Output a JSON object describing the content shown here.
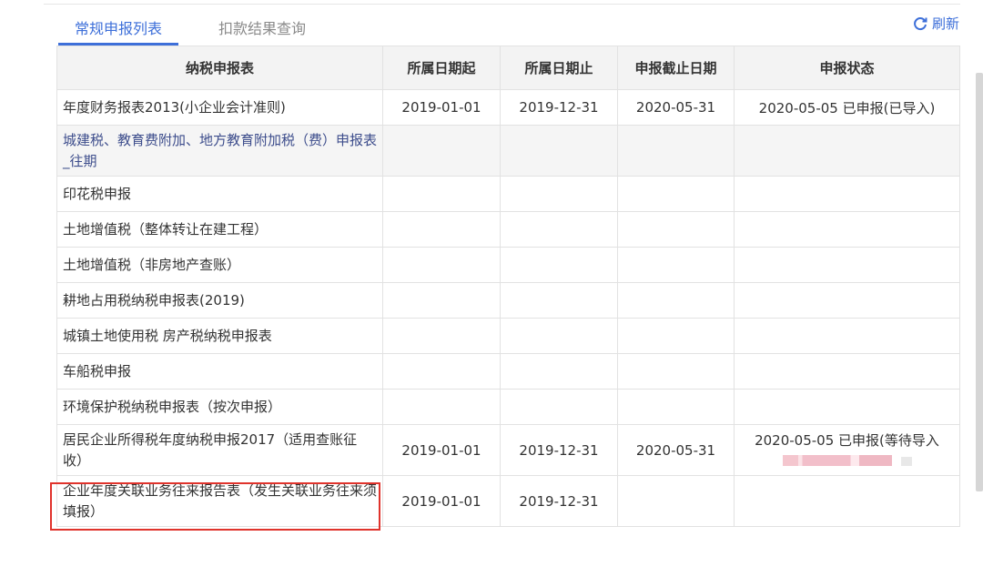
{
  "tabs": [
    {
      "label": "常规申报列表",
      "active": true
    },
    {
      "label": "扣款结果查询",
      "active": false
    }
  ],
  "refresh_label": "刷新",
  "table": {
    "headers": [
      "纳税申报表",
      "所属日期起",
      "所属日期止",
      "申报截止日期",
      "申报状态"
    ],
    "rows": [
      {
        "name": "年度财务报表2013(小企业会计准则)",
        "start": "2019-01-01",
        "end": "2019-12-31",
        "deadline": "2020-05-31",
        "status": "2020-05-05 已申报(已导入)"
      },
      {
        "name": "城建税、教育费附加、地方教育附加税（费）申报表_往期",
        "start": "",
        "end": "",
        "deadline": "",
        "status": ""
      },
      {
        "name": "印花税申报",
        "start": "",
        "end": "",
        "deadline": "",
        "status": ""
      },
      {
        "name": "土地增值税（整体转让在建工程）",
        "start": "",
        "end": "",
        "deadline": "",
        "status": ""
      },
      {
        "name": "土地增值税（非房地产查账）",
        "start": "",
        "end": "",
        "deadline": "",
        "status": ""
      },
      {
        "name": "耕地占用税纳税申报表(2019)",
        "start": "",
        "end": "",
        "deadline": "",
        "status": ""
      },
      {
        "name": "城镇土地使用税 房产税纳税申报表",
        "start": "",
        "end": "",
        "deadline": "",
        "status": ""
      },
      {
        "name": "车船税申报",
        "start": "",
        "end": "",
        "deadline": "",
        "status": ""
      },
      {
        "name": "环境保护税纳税申报表（按次申报）",
        "start": "",
        "end": "",
        "deadline": "",
        "status": ""
      },
      {
        "name": "居民企业所得税年度纳税申报2017（适用查账征收）",
        "start": "2019-01-01",
        "end": "2019-12-31",
        "deadline": "2020-05-31",
        "status": "2020-05-05 已申报(等待导入"
      },
      {
        "name": "企业年度关联业务往来报告表（发生关联业务往来须填报）",
        "start": "2019-01-01",
        "end": "2019-12-31",
        "deadline": "",
        "status": ""
      }
    ]
  },
  "colors": {
    "accent": "#3d6fd9",
    "highlight_border": "#e0332c"
  }
}
